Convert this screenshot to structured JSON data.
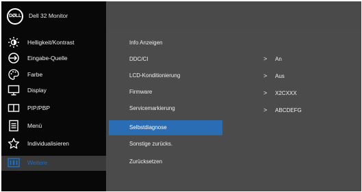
{
  "header": {
    "logo_text": "DØLL",
    "model": "Dell 32 Monitor"
  },
  "menu": [
    {
      "label": "Helligkeit/Kontrast",
      "icon": "brightness-icon"
    },
    {
      "label": "Eingabe-Quelle",
      "icon": "input-source-icon"
    },
    {
      "label": "Farbe",
      "icon": "palette-icon"
    },
    {
      "label": "Display",
      "icon": "display-icon"
    },
    {
      "label": "PIP/PBP",
      "icon": "pip-icon"
    },
    {
      "label": "Menü",
      "icon": "menu-icon"
    },
    {
      "label": "Individualisieren",
      "icon": "star-icon"
    },
    {
      "label": "Weitere",
      "icon": "info-icon",
      "selected": true
    }
  ],
  "submenu": [
    {
      "label": "Info Anzeigen"
    },
    {
      "label": "DDC/CI",
      "value": "An"
    },
    {
      "label": "LCD-Konditionierung",
      "value": "Aus"
    },
    {
      "label": "Firmware",
      "value": "X2CXXX"
    },
    {
      "label": "Servicemarkierung",
      "value": "ABCDEFG"
    },
    {
      "label": "Selbstdiagnose",
      "highlighted": true
    },
    {
      "label": "Sonstige zurücks."
    },
    {
      "label": "Zurücksetzen"
    }
  ],
  "chevron": ">",
  "colors": {
    "accent": "#2a6db5",
    "selected_text": "#1f6fbf",
    "panel_left": "#080808",
    "panel_right": "#4b4b4b"
  }
}
